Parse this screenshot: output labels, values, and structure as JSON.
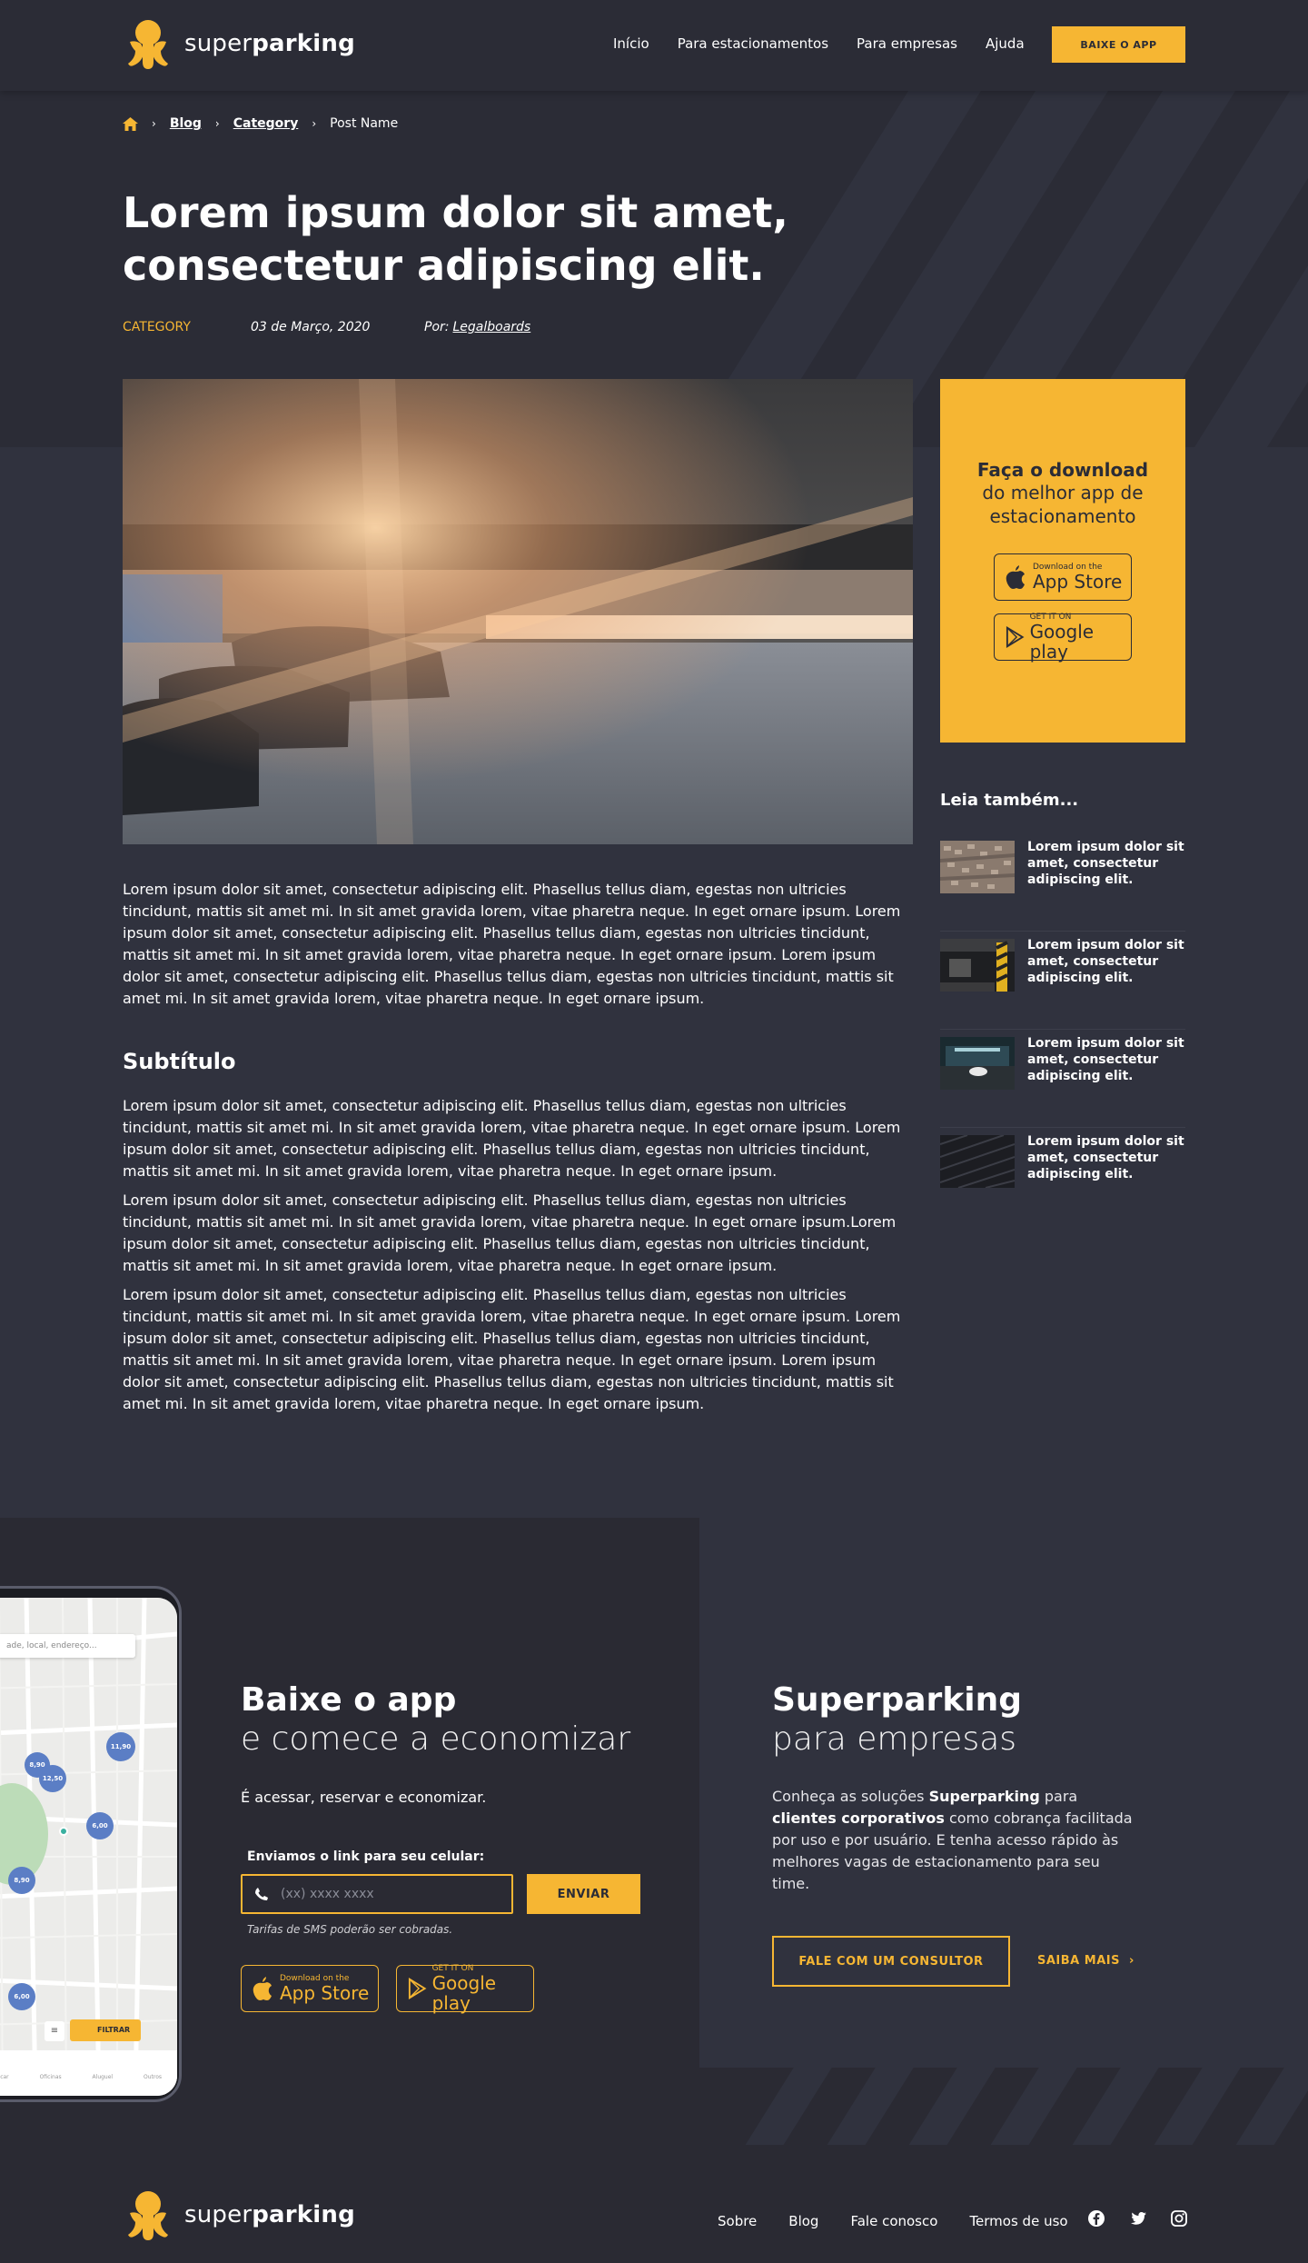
{
  "brand": {
    "name_light": "super",
    "name_bold": "parking",
    "accent": "#f6b633",
    "dark": "#2b2c36"
  },
  "nav": {
    "items": [
      "Início",
      "Para estacionamentos",
      "Para empresas",
      "Ajuda"
    ],
    "cta": "BAIXE O APP"
  },
  "breadcrumb": {
    "home_icon": "home-icon",
    "blog": "Blog",
    "category": "Category",
    "current": "Post Name"
  },
  "post": {
    "title": "Lorem ipsum dolor sit amet, consectetur adipiscing elit.",
    "category": "CATEGORY",
    "date": "03 de Março, 2020",
    "by_label": "Por:",
    "author": "Legalboards",
    "intro": "Lorem ipsum dolor sit amet, consectetur adipiscing elit. Phasellus tellus diam, egestas non ultricies tincidunt, mattis sit amet mi. In sit amet gravida lorem, vitae pharetra neque. In eget ornare ipsum. Lorem ipsum dolor sit amet, consectetur adipiscing elit. Phasellus tellus diam, egestas non ultricies tincidunt, mattis sit amet mi. In sit amet gravida lorem, vitae pharetra neque. In eget ornare ipsum. Lorem ipsum dolor sit amet, consectetur adipiscing elit. Phasellus tellus diam, egestas non ultricies tincidunt, mattis sit amet mi. In sit amet gravida lorem, vitae pharetra neque. In eget ornare ipsum.",
    "subtitle": "Subtítulo",
    "p1": "Lorem ipsum dolor sit amet, consectetur adipiscing elit. Phasellus tellus diam, egestas non ultricies tincidunt, mattis sit amet mi. In sit amet gravida lorem, vitae pharetra neque. In eget ornare ipsum. Lorem ipsum dolor sit amet, consectetur adipiscing elit. Phasellus tellus diam, egestas non ultricies tincidunt, mattis sit amet mi. In sit amet gravida lorem, vitae pharetra neque. In eget ornare ipsum.",
    "p2": "Lorem ipsum dolor sit amet, consectetur adipiscing elit. Phasellus tellus diam, egestas non ultricies tincidunt, mattis sit amet mi. In sit amet gravida lorem, vitae pharetra neque. In eget ornare ipsum.Lorem ipsum dolor sit amet, consectetur adipiscing elit. Phasellus tellus diam, egestas non ultricies tincidunt, mattis sit amet mi. In sit amet gravida lorem, vitae pharetra neque. In eget ornare ipsum.",
    "p3": "Lorem ipsum dolor sit amet, consectetur adipiscing elit. Phasellus tellus diam, egestas non ultricies tincidunt, mattis sit amet mi. In sit amet gravida lorem, vitae pharetra neque. In eget ornare ipsum. Lorem ipsum dolor sit amet, consectetur adipiscing elit. Phasellus tellus diam, egestas non ultricies tincidunt, mattis sit amet mi. In sit amet gravida lorem, vitae pharetra neque. In eget ornare ipsum. Lorem ipsum dolor sit amet, consectetur adipiscing elit. Phasellus tellus diam, egestas non ultricies tincidunt, mattis sit amet mi. In sit amet gravida lorem, vitae pharetra neque. In eget ornare ipsum."
  },
  "promo": {
    "line1": "Faça o download",
    "line2": "do melhor app de estacionamento",
    "appstore_small": "Download on the",
    "appstore_big": "App Store",
    "googleplay_small": "GET IT ON",
    "googleplay_big": "Google play"
  },
  "related": {
    "title": "Leia também...",
    "items": [
      "Lorem ipsum dolor sit amet, consectetur adipiscing elit.",
      "Lorem ipsum dolor sit amet, consectetur adipiscing elit.",
      "Lorem ipsum dolor sit amet, consectetur adipiscing elit.",
      "Lorem ipsum dolor sit amet, consectetur adipiscing elit."
    ]
  },
  "app_section": {
    "h1": "Baixe o app",
    "h2": "e comece a economizar",
    "text": "É acessar, reservar e economizar.",
    "phone_label": "Enviamos o link para seu celular:",
    "phone_placeholder": "(xx) xxxx xxxx",
    "send": "ENVIAR",
    "sms_note": "Tarifas de SMS poderão ser cobradas.",
    "mockup": {
      "search_placeholder": "ade, local, endereço...",
      "pins": [
        "8,90",
        "12,50",
        "11,90",
        "6,00",
        "8,90",
        "6,00"
      ],
      "filter": "FILTRAR",
      "tabs": [
        "Lavacar",
        "Oficinas",
        "Aluguel",
        "Outros"
      ]
    }
  },
  "biz_section": {
    "h1": "Superparking",
    "h2": "para empresas",
    "text_a": "Conheça as soluções",
    "text_b": "Superparking",
    "text_c": "para",
    "text_d": "clientes corporativos",
    "text_e": "como cobrança facilitada por uso e por usuário. E tenha acesso rápido às melhores vagas de estacionamento para seu time.",
    "consult": "FALE COM UM CONSULTOR",
    "more": "SAIBA MAIS"
  },
  "footer": {
    "links": [
      "Sobre",
      "Blog",
      "Fale conosco",
      "Termos de uso"
    ],
    "social": [
      "facebook-icon",
      "twitter-icon",
      "instagram-icon"
    ]
  }
}
